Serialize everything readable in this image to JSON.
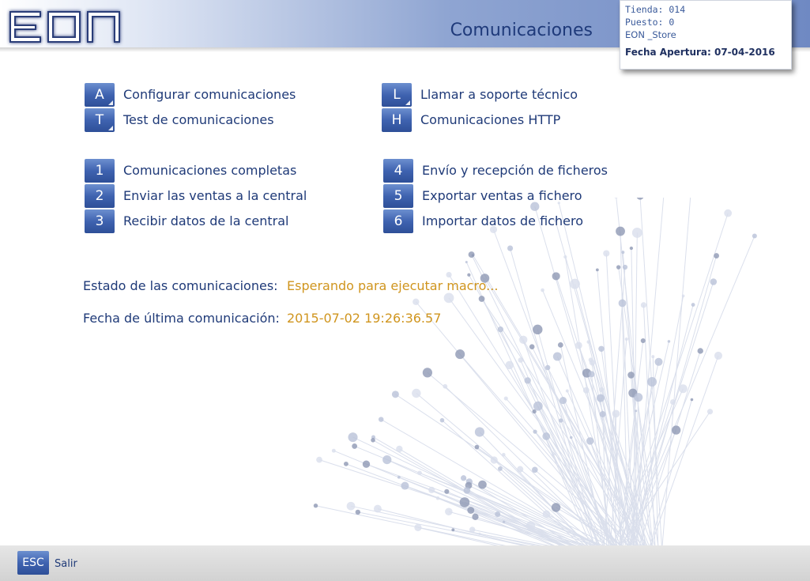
{
  "header": {
    "logo_text": "EON",
    "title": "Comunicaciones"
  },
  "info": {
    "tienda": "Tienda: 014",
    "puesto": "Puesto: 0",
    "store": "EON _Store",
    "fecha_apertura": "Fecha Apertura: 07-04-2016"
  },
  "menu": {
    "left": [
      {
        "key": "A",
        "label": "Configurar comunicaciones",
        "corner": true
      },
      {
        "key": "T",
        "label": "Test de comunicaciones",
        "corner": true
      },
      {
        "key": "1",
        "label": "Comunicaciones completas",
        "corner": false
      },
      {
        "key": "2",
        "label": "Enviar las ventas a la central",
        "corner": false
      },
      {
        "key": "3",
        "label": "Recibir datos de la central",
        "corner": false
      }
    ],
    "right": [
      {
        "key": "L",
        "label": "Llamar a soporte técnico",
        "corner": true
      },
      {
        "key": "H",
        "label": "Comunicaciones HTTP",
        "corner": false
      },
      {
        "key": "4",
        "label": "Envío y recepción de ficheros",
        "corner": false
      },
      {
        "key": "5",
        "label": "Exportar ventas a fichero",
        "corner": false
      },
      {
        "key": "6",
        "label": "Importar datos de fichero",
        "corner": false
      }
    ]
  },
  "status": {
    "estado_label": "Estado de las comunicaciones:",
    "estado_value": "Esperando para ejecutar macro...",
    "fecha_label": "Fecha de última comunicación:",
    "fecha_value": "2015-07-02 19:26:36.57"
  },
  "footer": {
    "esc_key": "ESC",
    "esc_label": "Salir"
  },
  "colors": {
    "accent": "#3f63b0",
    "text": "#1f3a78",
    "status_value": "#d0951e"
  }
}
